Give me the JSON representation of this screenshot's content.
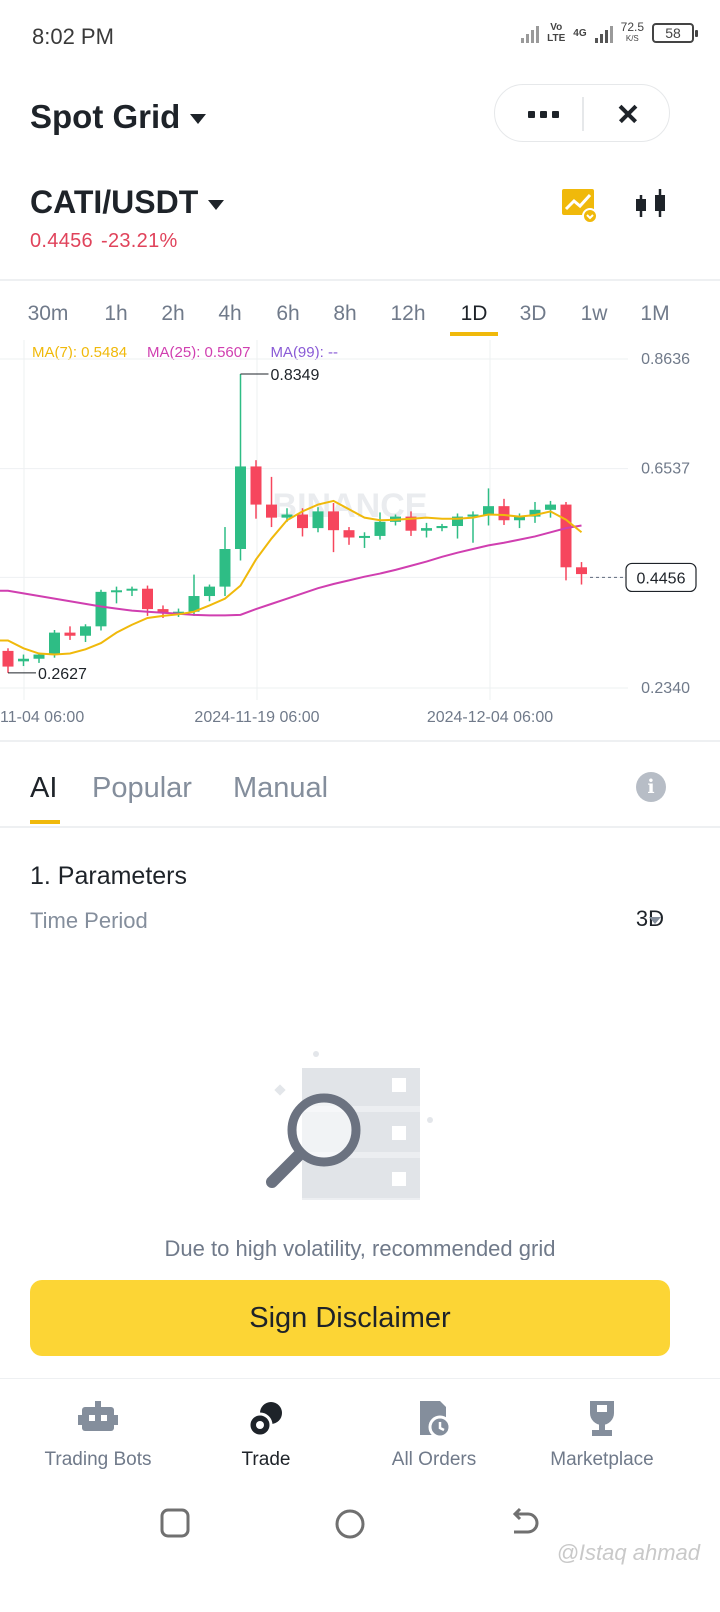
{
  "status_bar": {
    "time": "8:02 PM",
    "network_vo": "Vo",
    "network_lte": "LTE",
    "network_4g": "4G",
    "speed_value": "72.5",
    "speed_unit": "K/S",
    "battery": "58"
  },
  "header": {
    "title": "Spot Grid",
    "more_icon": "more-dots-icon",
    "close_icon": "close-icon"
  },
  "pair": {
    "symbol": "CATI/USDT",
    "price": "0.4456",
    "change": "-23.21%",
    "price_color": "#e0435b"
  },
  "intervals": {
    "items": [
      "30m",
      "1h",
      "2h",
      "4h",
      "6h",
      "8h",
      "12h",
      "1D",
      "3D",
      "1w",
      "1M"
    ],
    "active": "1D"
  },
  "moving_averages": {
    "ma7": "MA(7): 0.5484",
    "ma25": "MA(25): 0.5607",
    "ma99": "MA(99): --",
    "ma7_color": "#f0b90b",
    "ma25_color": "#d03fb0",
    "ma99_color": "#8a5bd6"
  },
  "chart_data": {
    "type": "candlestick",
    "watermark": "BINANCE",
    "y_ticks": [
      "0.8636",
      "0.6537",
      "0.4456",
      "0.2340"
    ],
    "x_ticks": [
      "11-04 06:00",
      "2024-11-19 06:00",
      "2024-12-04 06:00"
    ],
    "annotations": {
      "high": "0.8349",
      "low": "0.2627",
      "current": "0.4456"
    },
    "ylim": [
      0.234,
      0.8636
    ],
    "up_color": "#2ebd85",
    "down_color": "#f6465d",
    "candles": [
      {
        "o": 0.305,
        "h": 0.31,
        "c": 0.275,
        "l": 0.263
      },
      {
        "o": 0.285,
        "h": 0.298,
        "c": 0.29,
        "l": 0.276
      },
      {
        "o": 0.29,
        "h": 0.302,
        "c": 0.298,
        "l": 0.282
      },
      {
        "o": 0.298,
        "h": 0.345,
        "c": 0.34,
        "l": 0.292
      },
      {
        "o": 0.34,
        "h": 0.352,
        "c": 0.334,
        "l": 0.326
      },
      {
        "o": 0.334,
        "h": 0.356,
        "c": 0.352,
        "l": 0.322
      },
      {
        "o": 0.352,
        "h": 0.422,
        "c": 0.418,
        "l": 0.344
      },
      {
        "o": 0.418,
        "h": 0.428,
        "c": 0.421,
        "l": 0.396
      },
      {
        "o": 0.421,
        "h": 0.428,
        "c": 0.424,
        "l": 0.41
      },
      {
        "o": 0.424,
        "h": 0.43,
        "c": 0.385,
        "l": 0.372
      },
      {
        "o": 0.385,
        "h": 0.392,
        "c": 0.378,
        "l": 0.368
      },
      {
        "o": 0.378,
        "h": 0.386,
        "c": 0.38,
        "l": 0.37
      },
      {
        "o": 0.38,
        "h": 0.451,
        "c": 0.41,
        "l": 0.372
      },
      {
        "o": 0.41,
        "h": 0.432,
        "c": 0.428,
        "l": 0.4
      },
      {
        "o": 0.428,
        "h": 0.542,
        "c": 0.5,
        "l": 0.41
      },
      {
        "o": 0.5,
        "h": 0.835,
        "c": 0.658,
        "l": 0.478
      },
      {
        "o": 0.658,
        "h": 0.67,
        "c": 0.585,
        "l": 0.558
      },
      {
        "o": 0.585,
        "h": 0.638,
        "c": 0.56,
        "l": 0.542
      },
      {
        "o": 0.56,
        "h": 0.578,
        "c": 0.566,
        "l": 0.552
      },
      {
        "o": 0.566,
        "h": 0.578,
        "c": 0.54,
        "l": 0.524
      },
      {
        "o": 0.54,
        "h": 0.58,
        "c": 0.572,
        "l": 0.532
      },
      {
        "o": 0.572,
        "h": 0.588,
        "c": 0.536,
        "l": 0.494
      },
      {
        "o": 0.536,
        "h": 0.542,
        "c": 0.522,
        "l": 0.508
      },
      {
        "o": 0.522,
        "h": 0.532,
        "c": 0.525,
        "l": 0.502
      },
      {
        "o": 0.525,
        "h": 0.57,
        "c": 0.552,
        "l": 0.518
      },
      {
        "o": 0.552,
        "h": 0.566,
        "c": 0.562,
        "l": 0.545
      },
      {
        "o": 0.562,
        "h": 0.572,
        "c": 0.535,
        "l": 0.525
      },
      {
        "o": 0.535,
        "h": 0.55,
        "c": 0.54,
        "l": 0.522
      },
      {
        "o": 0.54,
        "h": 0.548,
        "c": 0.544,
        "l": 0.534
      },
      {
        "o": 0.544,
        "h": 0.568,
        "c": 0.562,
        "l": 0.52
      },
      {
        "o": 0.562,
        "h": 0.572,
        "c": 0.566,
        "l": 0.512
      },
      {
        "o": 0.566,
        "h": 0.616,
        "c": 0.582,
        "l": 0.545
      },
      {
        "o": 0.582,
        "h": 0.596,
        "c": 0.555,
        "l": 0.546
      },
      {
        "o": 0.555,
        "h": 0.568,
        "c": 0.562,
        "l": 0.54
      },
      {
        "o": 0.562,
        "h": 0.59,
        "c": 0.575,
        "l": 0.55
      },
      {
        "o": 0.575,
        "h": 0.592,
        "c": 0.585,
        "l": 0.56
      },
      {
        "o": 0.585,
        "h": 0.59,
        "c": 0.465,
        "l": 0.44
      },
      {
        "o": 0.465,
        "h": 0.475,
        "c": 0.452,
        "l": 0.432
      }
    ],
    "ma7_values": [
      0.325,
      0.31,
      0.3,
      0.298,
      0.3,
      0.308,
      0.32,
      0.34,
      0.355,
      0.368,
      0.372,
      0.375,
      0.38,
      0.392,
      0.405,
      0.43,
      0.48,
      0.52,
      0.555,
      0.572,
      0.585,
      0.592,
      0.576,
      0.56,
      0.555,
      0.556,
      0.558,
      0.56,
      0.558,
      0.558,
      0.56,
      0.566,
      0.565,
      0.562,
      0.565,
      0.572,
      0.556,
      0.532
    ],
    "ma25_values": [
      0.42,
      0.415,
      0.41,
      0.405,
      0.4,
      0.395,
      0.39,
      0.386,
      0.382,
      0.38,
      0.378,
      0.376,
      0.374,
      0.373,
      0.373,
      0.374,
      0.385,
      0.395,
      0.405,
      0.415,
      0.425,
      0.433,
      0.44,
      0.447,
      0.453,
      0.46,
      0.468,
      0.476,
      0.485,
      0.493,
      0.5,
      0.507,
      0.512,
      0.518,
      0.524,
      0.532,
      0.54,
      0.545
    ]
  },
  "strategy_tabs": {
    "items": [
      "AI",
      "Popular",
      "Manual"
    ],
    "active": "AI",
    "info_icon": "info-icon"
  },
  "parameters": {
    "title": "1. Parameters",
    "period_label": "Time Period",
    "period_value": "3D"
  },
  "empty_state": {
    "illustration": "search-magnifier-icon",
    "text": "Due to high volatility, recommended grid"
  },
  "cta": {
    "label": "Sign Disclaimer"
  },
  "bottom_nav": {
    "items": [
      {
        "label": "Trading Bots",
        "icon": "robot-icon"
      },
      {
        "label": "Trade",
        "icon": "trade-icon"
      },
      {
        "label": "All Orders",
        "icon": "orders-icon"
      },
      {
        "label": "Marketplace",
        "icon": "trophy-icon"
      }
    ],
    "active": "Trade"
  },
  "watermark": "@Istaq ahmad"
}
